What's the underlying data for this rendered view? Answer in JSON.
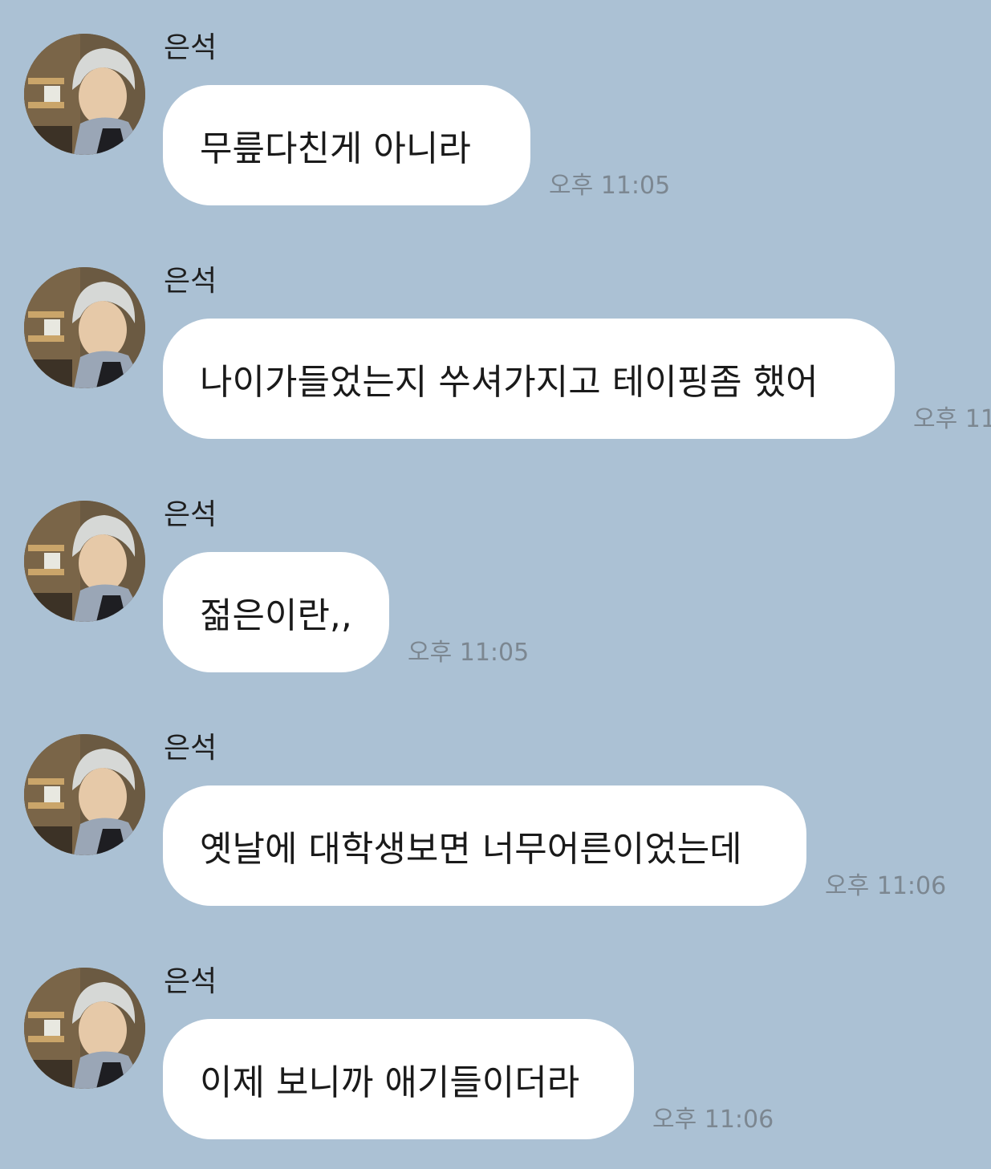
{
  "chat": {
    "messages": [
      {
        "sender": "은석",
        "text": "무릎다친게 아니라",
        "time": "오후 11:05"
      },
      {
        "sender": "은석",
        "text": "나이가들었는지 쑤셔가지고 테이핑좀 했어",
        "time": "오후 11"
      },
      {
        "sender": "은석",
        "text": "젊은이란,,",
        "time": "오후 11:05"
      },
      {
        "sender": "은석",
        "text": "옛날에 대학생보면 너무어른이었는데",
        "time": "오후 11:06"
      },
      {
        "sender": "은석",
        "text": "이제 보니까 애기들이더라",
        "time": "오후 11:06"
      }
    ]
  },
  "icons": {
    "avatar": "profile-photo"
  },
  "colors": {
    "background": "#abc1d4",
    "bubble": "#ffffff",
    "time_text": "#7c8791"
  }
}
